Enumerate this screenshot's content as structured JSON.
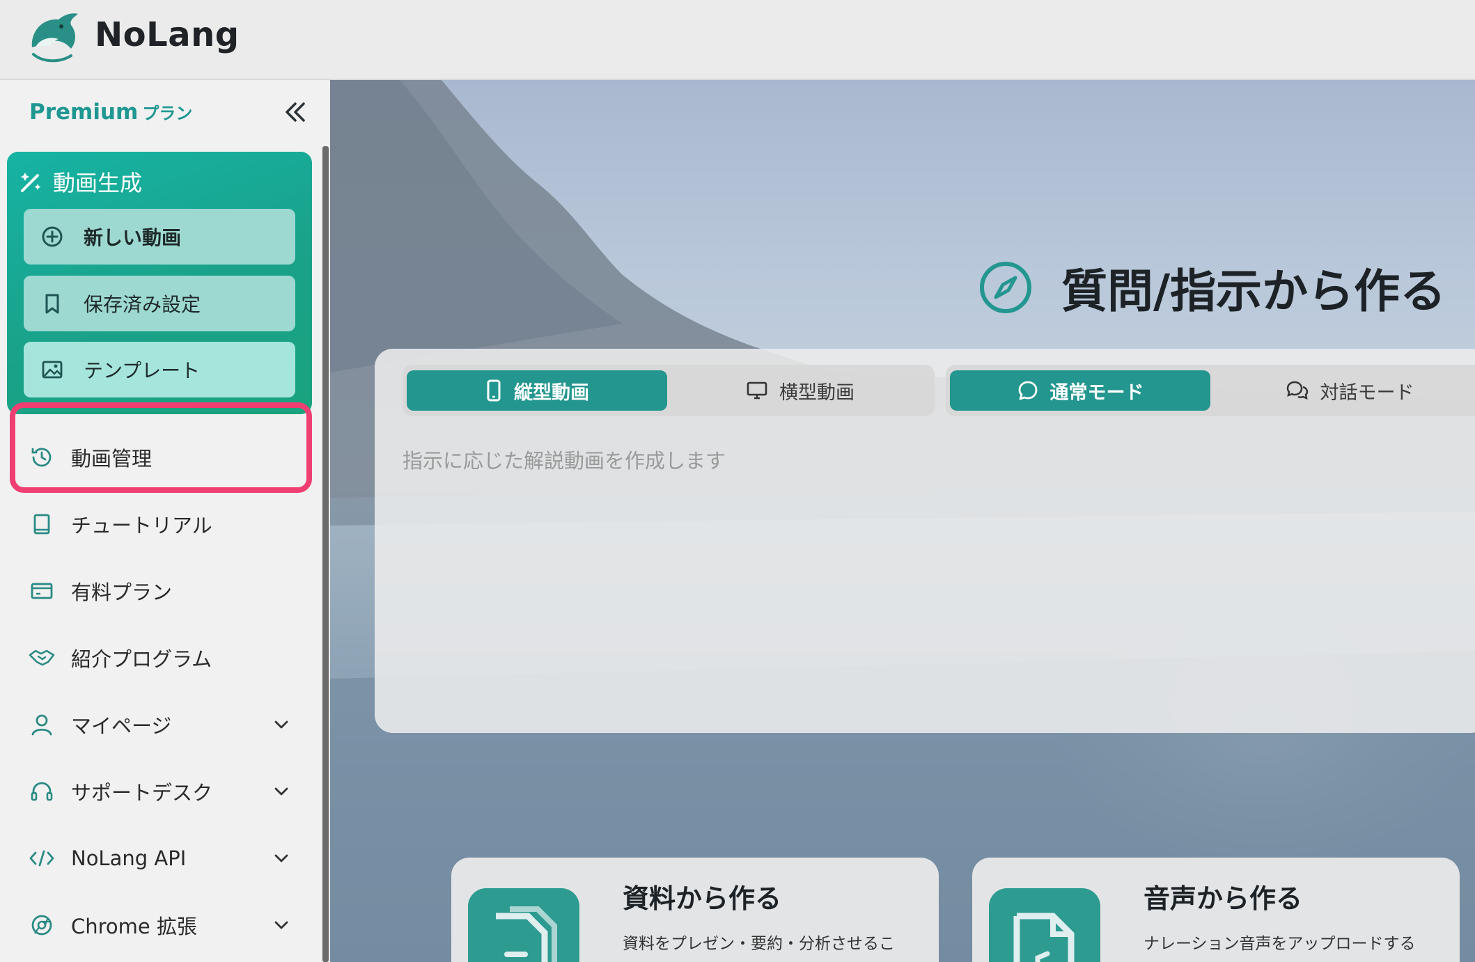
{
  "app": {
    "title": "NoLang"
  },
  "sidebar": {
    "plan": "Premium",
    "plan_suffix": "プラン",
    "generation": {
      "title": "動画生成",
      "new_video": "新しい動画",
      "saved_settings": "保存済み設定",
      "template": "テンプレート"
    },
    "items": [
      {
        "label": "動画管理",
        "icon": "history-icon"
      },
      {
        "label": "チュートリアル",
        "icon": "book-icon"
      },
      {
        "label": "有料プラン",
        "icon": "credit-card-icon"
      },
      {
        "label": "紹介プログラム",
        "icon": "handshake-icon"
      },
      {
        "label": "マイページ",
        "icon": "user-icon"
      },
      {
        "label": "サポートデスク",
        "icon": "headset-icon"
      },
      {
        "label": "NoLang API",
        "icon": "code-icon"
      },
      {
        "label": "Chrome 拡張",
        "icon": "chrome-icon"
      }
    ]
  },
  "main": {
    "section_title": "質問/指示から作る",
    "orientation": {
      "vertical": "縦型動画",
      "horizontal": "横型動画",
      "selected": "縦型動画"
    },
    "mode": {
      "normal": "通常モード",
      "dialog": "対話モード",
      "selected": "通常モード"
    },
    "prompt_placeholder": "指示に応じた解説動画を作成します",
    "cards": [
      {
        "title": "資料から作る",
        "desc": "資料をプレゼン・要約・分析させるこ"
      },
      {
        "title": "音声から作る",
        "desc": "ナレーション音声をアップロードする"
      }
    ]
  },
  "colors": {
    "accent": "#23968f",
    "highlight": "#ef3f72",
    "plan": "#1f9792"
  }
}
